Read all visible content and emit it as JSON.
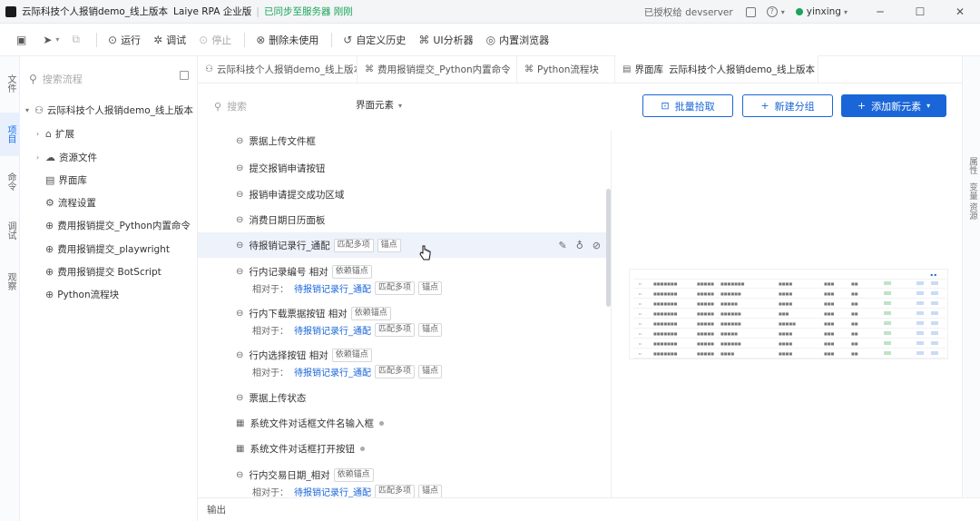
{
  "title_bar": {
    "project": "云际科技个人报销demo_线上版本",
    "app": "Laiye RPA 企业版",
    "sync_status": "已同步至服务器 刚刚",
    "authorized": "已授权给 devserver",
    "user": "yinxing"
  },
  "toolbar": {
    "items": [
      {
        "label": "运行",
        "icon": "play-icon"
      },
      {
        "label": "调试",
        "icon": "debug-icon"
      },
      {
        "label": "停止",
        "icon": "stop-icon"
      },
      {
        "label": "删除未使用",
        "icon": "delete-icon"
      },
      {
        "label": "自定义历史",
        "icon": "history-icon"
      },
      {
        "label": "UI分析器",
        "icon": "analyzer-icon"
      },
      {
        "label": "内置浏览器",
        "icon": "browser-icon"
      }
    ]
  },
  "activity_bar": {
    "items": [
      "文件",
      "项目",
      "命令",
      "调试",
      "观察"
    ]
  },
  "sidebar": {
    "search_placeholder": "搜索流程",
    "root": "云际科技个人报销demo_线上版本",
    "items": [
      {
        "label": "扩展",
        "icon": "extension-icon",
        "expandable": true
      },
      {
        "label": "资源文件",
        "icon": "cloud-icon",
        "expandable": true
      },
      {
        "label": "界面库",
        "icon": "library-icon",
        "expandable": false
      },
      {
        "label": "流程设置",
        "icon": "settings-icon",
        "expandable": false
      },
      {
        "label": "费用报销提交_Python内置命令",
        "icon": "flow-icon",
        "expandable": false
      },
      {
        "label": "费用报销提交_playwright",
        "icon": "flow-icon",
        "expandable": false
      },
      {
        "label": "费用报销提交 BotScript",
        "icon": "flow-icon",
        "expandable": false
      },
      {
        "label": "Python流程块",
        "icon": "python-icon",
        "expandable": false
      }
    ]
  },
  "tabs": [
    {
      "label": "云际科技个人报销demo_线上版本",
      "icon": "flow-icon",
      "active": false
    },
    {
      "label": "费用报销提交_Python内置命令",
      "icon": "python-icon",
      "active": false
    },
    {
      "label": "Python流程块",
      "icon": "python-icon",
      "active": false
    },
    {
      "label": "界面库",
      "icon": "library-icon",
      "active": true,
      "suffix": "云际科技个人报销demo_线上版本"
    }
  ],
  "filter": {
    "search_placeholder": "搜索",
    "type_label": "界面元素",
    "buttons": {
      "batch_pick": "批量拾取",
      "new_group": "新建分组",
      "add_element": "添加新元素"
    }
  },
  "elements": [
    {
      "name": "票据上传文件框",
      "tags": [],
      "sub": null
    },
    {
      "name": "提交报销申请按钮",
      "tags": [],
      "sub": null
    },
    {
      "name": "报销申请提交成功区域",
      "tags": [],
      "sub": null
    },
    {
      "name": "消费日期日历面板",
      "tags": [],
      "sub": null
    },
    {
      "name": "待报销记录行_通配",
      "tags": [
        "匹配多项",
        "锚点"
      ],
      "sub": null,
      "highlight": true
    },
    {
      "name": "行内记录编号 相对",
      "tags": [
        "依赖锚点"
      ],
      "sub": {
        "prefix": "相对于：",
        "link": "待报销记录行_通配",
        "tags": [
          "匹配多项",
          "锚点"
        ]
      }
    },
    {
      "name": "行内下载票据按钮 相对",
      "tags": [
        "依赖锚点"
      ],
      "sub": {
        "prefix": "相对于：",
        "link": "待报销记录行_通配",
        "tags": [
          "匹配多项",
          "锚点"
        ]
      }
    },
    {
      "name": "行内选择按钮 相对",
      "tags": [
        "依赖锚点"
      ],
      "sub": {
        "prefix": "相对于：",
        "link": "待报销记录行_通配",
        "tags": [
          "匹配多项",
          "锚点"
        ]
      }
    },
    {
      "name": "票据上传状态",
      "tags": [],
      "sub": null
    },
    {
      "name": "系统文件对话框文件名输入框",
      "tags": [],
      "sub": null,
      "dot": true
    },
    {
      "name": "系统文件对话框打开按钮",
      "tags": [],
      "sub": null,
      "dot": true
    },
    {
      "name": "行内交易日期_相对",
      "tags": [
        "依赖锚点"
      ],
      "sub": {
        "prefix": "相对于：",
        "link": "待报销记录行_通配",
        "tags": [
          "匹配多项",
          "锚点"
        ]
      }
    }
  ],
  "right_bar": [
    "属性",
    "变量",
    "资源"
  ],
  "output_label": "输出",
  "colors": {
    "primary": "#1a66d8",
    "green": "#1aa55a",
    "highlight": "#eef2fb"
  }
}
